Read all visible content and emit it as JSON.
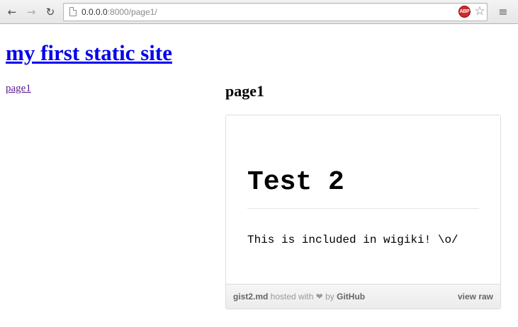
{
  "browser": {
    "url_host": "0.0.0.0",
    "url_rest": ":8000/page1/",
    "back_icon": "←",
    "forward_icon": "→",
    "reload_icon": "↻",
    "abp_label": "ABP",
    "star_icon": "☆",
    "menu_icon": "≡"
  },
  "site": {
    "title": "my first static site",
    "nav": [
      {
        "label": "page1"
      }
    ]
  },
  "page": {
    "heading": "page1"
  },
  "gist": {
    "heading": "Test 2",
    "paragraph": "This is included in wigiki! \\o/",
    "filename": "gist2.md",
    "hosted_text": " hosted with ❤ by ",
    "host_name": "GitHub",
    "view_raw": "view raw"
  }
}
